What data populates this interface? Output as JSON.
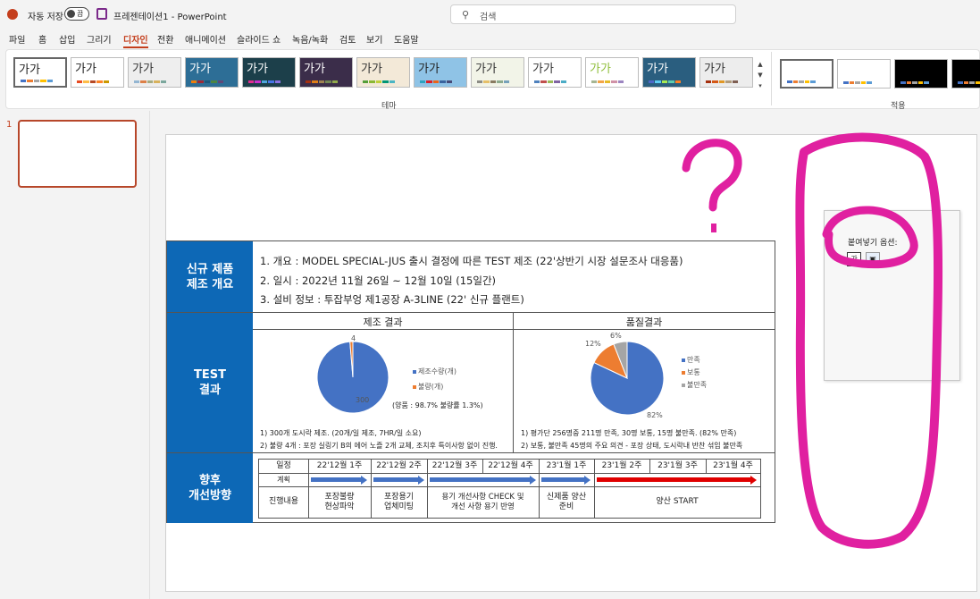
{
  "titlebar": {
    "autosave_label": "자동 저장",
    "autosave_state": "끔",
    "file_name": "프레젠테이션1  -  PowerPoint",
    "search_placeholder": "검색"
  },
  "menu": {
    "tabs": [
      "파일",
      "홈",
      "삽입",
      "그리기",
      "디자인",
      "전환",
      "애니메이션",
      "슬라이드 쇼",
      "녹음/녹화",
      "검토",
      "보기",
      "도움말"
    ],
    "active": "디자인"
  },
  "ribbon": {
    "theme_sample": "가가",
    "themes_group_label": "테마",
    "variants_group_label": "적용",
    "themes": [
      {
        "bg": "#ffffff",
        "fg": "#222222",
        "bars": [
          "#4472c4",
          "#ed7d31",
          "#a5a5a5",
          "#ffc000",
          "#5b9bd5"
        ]
      },
      {
        "bg": "#ffffff",
        "fg": "#222222",
        "bars": [
          "#e84c22",
          "#ffbd47",
          "#b64926",
          "#ff8427",
          "#cc9900"
        ]
      },
      {
        "bg": "#eeeeee",
        "fg": "#333333",
        "bars": [
          "#94b6d2",
          "#dd8047",
          "#a5ab81",
          "#d8b25c",
          "#7ba79d"
        ]
      },
      {
        "bg": "#2d6e96",
        "fg": "#ffffff",
        "bars": [
          "#f07f09",
          "#9f2936",
          "#1b587c",
          "#4e8542",
          "#604878"
        ]
      },
      {
        "bg": "#1c3f4a",
        "fg": "#ffffff",
        "bars": [
          "#e32d91",
          "#c830cc",
          "#4ea6dc",
          "#4775e7",
          "#8971e1"
        ]
      },
      {
        "bg": "#3b2d4a",
        "fg": "#ffffff",
        "bars": [
          "#a53010",
          "#de7e18",
          "#9f8351",
          "#728653",
          "#92aa4c"
        ]
      },
      {
        "bg": "#f3e9d8",
        "fg": "#333333",
        "bars": [
          "#549e39",
          "#8ab833",
          "#c0cf3a",
          "#029676",
          "#4ab5c4"
        ]
      },
      {
        "bg": "#8fc3e6",
        "fg": "#222222",
        "bars": [
          "#2da2bf",
          "#da1f28",
          "#eb641b",
          "#39639d",
          "#474b78"
        ]
      },
      {
        "bg": "#f2f4e8",
        "fg": "#333333",
        "bars": [
          "#8c8d86",
          "#e6c069",
          "#897b61",
          "#8dab8e",
          "#77a2bb"
        ]
      },
      {
        "bg": "#ffffff",
        "fg": "#333333",
        "bars": [
          "#4f81bd",
          "#c0504d",
          "#9bbb59",
          "#8064a2",
          "#4bacc6"
        ]
      },
      {
        "bg": "#ffffff",
        "fg": "#8fbf3a",
        "bars": [
          "#a5b592",
          "#f3a447",
          "#e7bc29",
          "#d092a7",
          "#9c85c0"
        ]
      },
      {
        "bg": "#2a5e7f",
        "fg": "#ffffff",
        "bars": [
          "#4e67c8",
          "#5eccf3",
          "#a7ea52",
          "#5dceaf",
          "#ff8021"
        ]
      },
      {
        "bg": "#ededed",
        "fg": "#333333",
        "bars": [
          "#a5300f",
          "#d55816",
          "#e19825",
          "#b19c7d",
          "#7f5f52"
        ]
      }
    ],
    "variants": [
      {
        "bg": "#ffffff",
        "bars": [
          "#4472c4",
          "#ed7d31",
          "#a5a5a5",
          "#ffc000",
          "#5b9bd5"
        ]
      },
      {
        "bg": "#ffffff",
        "bars": [
          "#4472c4",
          "#ed7d31",
          "#a5a5a5",
          "#ffc000",
          "#5b9bd5"
        ]
      },
      {
        "bg": "#000000",
        "bars": [
          "#4472c4",
          "#ed7d31",
          "#a5a5a5",
          "#ffc000",
          "#5b9bd5"
        ]
      },
      {
        "bg": "#000000",
        "bars": [
          "#4472c4",
          "#ed7d31",
          "#a5a5a5",
          "#ffc000",
          "#5b9bd5"
        ]
      }
    ]
  },
  "thumbnails": {
    "slide_number": "1"
  },
  "slide": {
    "sections": {
      "overview": "신규 제품\n제조 개요",
      "test": "TEST\n결과",
      "improve": "향후\n개선방향"
    },
    "overview_lines": [
      "1. 개요 : MODEL SPECIAL-JUS 출시 결정에 따른 TEST 제조 (22'상반기 시장 설문조사 대응품)",
      "2. 일시 : 2022년 11월 26일 ~ 12월 10일 (15일간)",
      "3. 설비 정보 : 투잡부엉 제1공장 A-3LINE (22' 신규 플랜트)"
    ],
    "manufacturing": {
      "title": "제조 결과",
      "yield_note": "(양품 : 98.7% 불량률 1.3%)",
      "notes": [
        "1) 300개 도시락 제조. (20개/일 제조, 7HR/일 소요)",
        "2) 불량 4개 : 포장 실링기 B의 에어 노즐 2개 교체, 조치후 특이사항 없이 진행."
      ]
    },
    "quality": {
      "title": "품질결과",
      "notes": [
        "1) 평가단 256명중 211명 만족, 30명 보통, 15명 불만족. (82% 만족)",
        "2) 보통, 불만족 45명의 주요 의견 - 포장 상태, 도시락내 반찬 섞임 불만족"
      ]
    },
    "schedule": {
      "row_labels": [
        "일정",
        "계획",
        "진행내용"
      ],
      "weeks": [
        "22'12월 1주",
        "22'12월 2주",
        "22'12월 3주",
        "22'12월 4주",
        "23'1월 1주",
        "23'1월 2주",
        "23'1월 3주",
        "23'1월 4주"
      ],
      "contents": [
        "포장불량\n현상파악",
        "포장용기\n업체미팅",
        "용기 개선사항 CHECK 및\n개선 사항 용기 반영",
        "신제품 양산\n준비",
        "양산 START"
      ],
      "plan_color": "#4472c4",
      "start_color": "#e00000"
    }
  },
  "chart_data": [
    {
      "type": "pie",
      "title": "제조 결과",
      "categories": [
        "제조수량(개)",
        "불량(개)"
      ],
      "values": [
        300,
        4
      ],
      "data_labels": [
        "300",
        "4"
      ],
      "colors": [
        "#4472c4",
        "#ed7d31"
      ],
      "legend": "right"
    },
    {
      "type": "pie",
      "title": "품질결과",
      "categories": [
        "만족",
        "보통",
        "불만족"
      ],
      "values": [
        82,
        12,
        6
      ],
      "data_labels": [
        "82%",
        "12%",
        "6%"
      ],
      "colors": [
        "#4472c4",
        "#ed7d31",
        "#a5a5a5"
      ],
      "legend": "right"
    }
  ],
  "paste_options": {
    "title": "붙여넣기 옵션:",
    "icon1": "가"
  },
  "annotation": {
    "question_mark": "?",
    "ink_color": "#e020a0"
  }
}
